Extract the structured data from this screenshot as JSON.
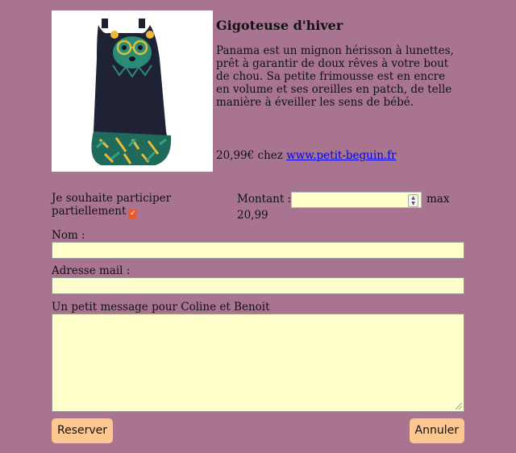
{
  "product": {
    "title": "Gigoteuse d'hiver",
    "description": "Panama est un mignon hérisson à lunettes, prêt à garantir de doux rêves à votre bout de chou. Sa petite frimousse est en encre en volume et ses oreilles en patch, de telle manière à éveiller les sens de bébé.",
    "price_prefix": "20,99€ chez ",
    "shop_link": "www.petit-beguin.fr"
  },
  "form": {
    "participate_label": "Je souhaite participer partiellement",
    "participate_checked": true,
    "amount_label": "Montant :",
    "amount_value": "",
    "max_label": "max",
    "max_value": "20,99",
    "name_label": "Nom :",
    "name_value": "",
    "email_label": "Adresse mail :",
    "email_value": "",
    "message_label": "Un petit message pour Coline et Benoit",
    "message_value": ""
  },
  "buttons": {
    "reserve": "Reserver",
    "cancel": "Annuler"
  },
  "colors": {
    "page_background": "#a8748f",
    "field_background": "#ffffcc",
    "button_background": "#fdc78f",
    "link": "#0000ee",
    "checkbox": "#ea5a2b"
  }
}
